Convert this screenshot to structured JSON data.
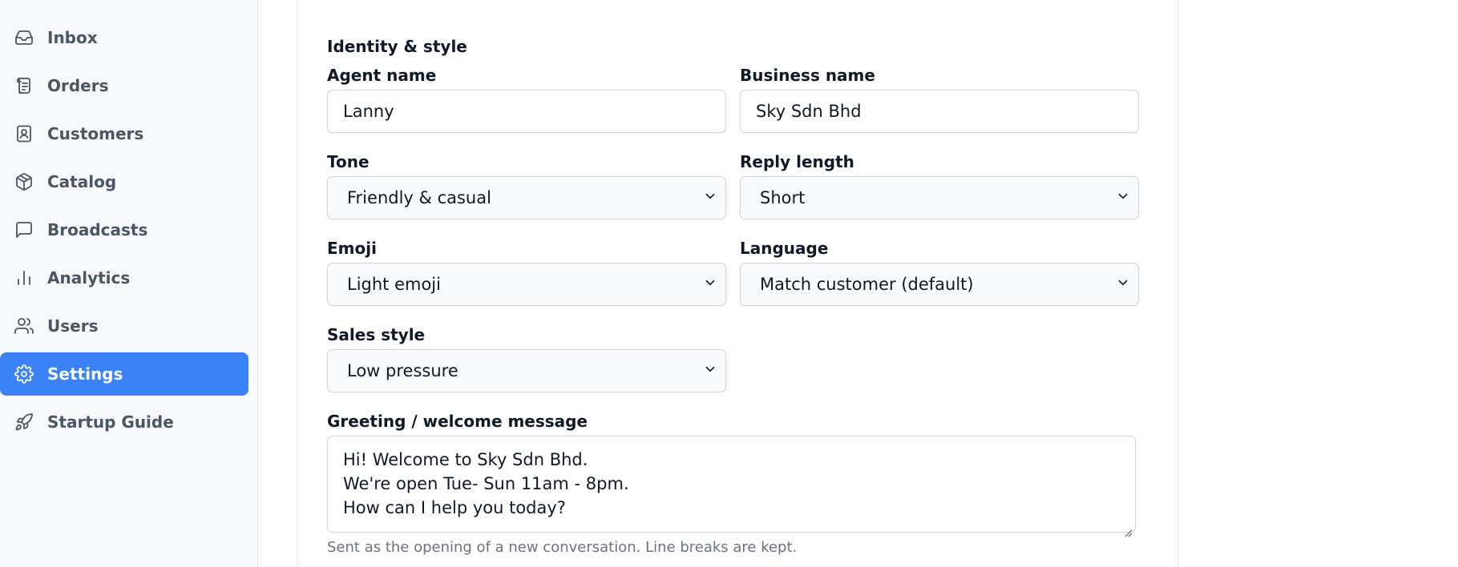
{
  "sidebar": {
    "items": [
      {
        "label": "Inbox",
        "icon": "inbox-icon"
      },
      {
        "label": "Orders",
        "icon": "receipt-icon"
      },
      {
        "label": "Customers",
        "icon": "contact-book-icon"
      },
      {
        "label": "Catalog",
        "icon": "package-icon"
      },
      {
        "label": "Broadcasts",
        "icon": "message-square-icon"
      },
      {
        "label": "Analytics",
        "icon": "bar-chart-icon"
      },
      {
        "label": "Users",
        "icon": "users-icon"
      },
      {
        "label": "Settings",
        "icon": "gear-icon",
        "active": true
      },
      {
        "label": "Startup Guide",
        "icon": "rocket-icon"
      }
    ],
    "active_color": "#3b82f6"
  },
  "form": {
    "section_title": "Identity & style",
    "agent_name": {
      "label": "Agent name",
      "value": "Lanny"
    },
    "business_name": {
      "label": "Business name",
      "value": "Sky Sdn Bhd"
    },
    "tone": {
      "label": "Tone",
      "value": "Friendly & casual"
    },
    "reply_length": {
      "label": "Reply length",
      "value": "Short"
    },
    "emoji": {
      "label": "Emoji",
      "value": "Light emoji"
    },
    "language": {
      "label": "Language",
      "value": "Match customer (default)"
    },
    "sales_style": {
      "label": "Sales style",
      "value": "Low pressure"
    },
    "greeting": {
      "label": "Greeting / welcome message",
      "lines": [
        "Hi! Welcome to Sky Sdn Bhd.",
        "We're open Tue- Sun 11am - 8pm.",
        "How can I help you today?"
      ],
      "hint": "Sent as the opening of a new conversation. Line breaks are kept."
    }
  }
}
